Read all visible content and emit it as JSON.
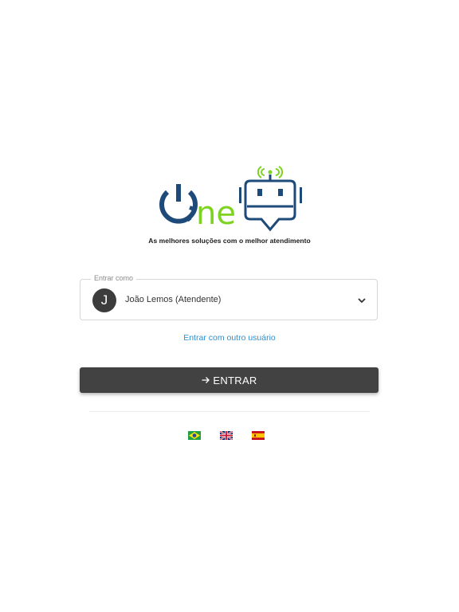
{
  "logo": {
    "text": "One",
    "tagline": "As melhores soluções com o melhor atendimento",
    "colors": {
      "blue": "#1e4a7a",
      "green": "#7ed321"
    }
  },
  "login": {
    "select_legend": "Entrar como",
    "avatar_initial": "J",
    "selected_user": "João Lemos (Atendente)",
    "other_user_link": "Entrar com outro usuário",
    "enter_button": "ENTRAR"
  },
  "languages": [
    {
      "name": "Português",
      "icon": "brazil-flag-icon"
    },
    {
      "name": "English",
      "icon": "uk-flag-icon"
    },
    {
      "name": "Español",
      "icon": "spain-flag-icon"
    }
  ],
  "colors": {
    "button_bg": "#424242",
    "link": "#2e8fcf"
  }
}
